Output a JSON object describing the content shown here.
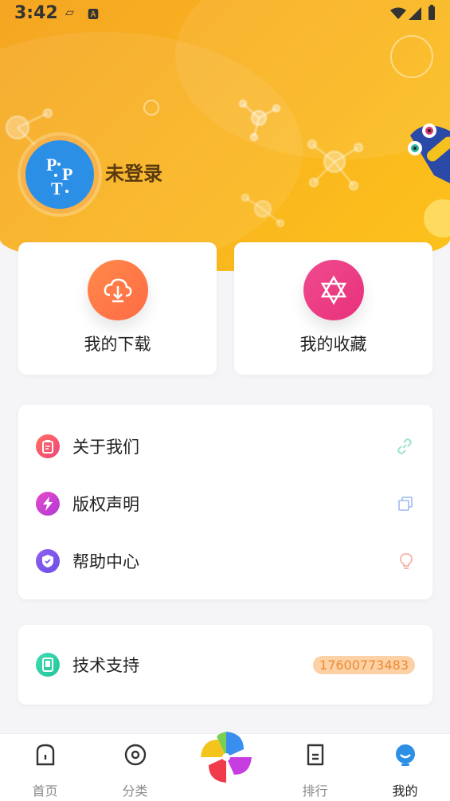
{
  "status_bar": {
    "time": "3:42"
  },
  "profile": {
    "username": "未登录",
    "avatar_initials": "P T P"
  },
  "quick_actions": [
    {
      "label": "我的下载",
      "icon": "cloud-download-icon",
      "color": "#ff7a4a"
    },
    {
      "label": "我的收藏",
      "icon": "star-of-david-icon",
      "color": "#ef3e86"
    }
  ],
  "menu": {
    "items": [
      {
        "label": "关于我们",
        "icon": "clipboard-icon",
        "right_icon": "link-icon"
      },
      {
        "label": "版权声明",
        "icon": "lightning-icon",
        "right_icon": "copy-icon"
      },
      {
        "label": "帮助中心",
        "icon": "shield-icon",
        "right_icon": "bulb-icon"
      }
    ]
  },
  "support": {
    "label": "技术支持",
    "phone": "17600773483",
    "icon": "phone-icon"
  },
  "tabbar": {
    "tabs": [
      {
        "label": "首页",
        "icon": "home-icon"
      },
      {
        "label": "分类",
        "icon": "category-icon"
      },
      {
        "label": "",
        "icon": "pinwheel-icon"
      },
      {
        "label": "排行",
        "icon": "ranking-icon"
      },
      {
        "label": "我的",
        "icon": "profile-icon"
      }
    ],
    "active": "我的"
  },
  "colors": {
    "header": "#f9b21f",
    "accent_badge_bg": "#fcd1a6",
    "accent_badge_text": "#ef8a2e"
  }
}
